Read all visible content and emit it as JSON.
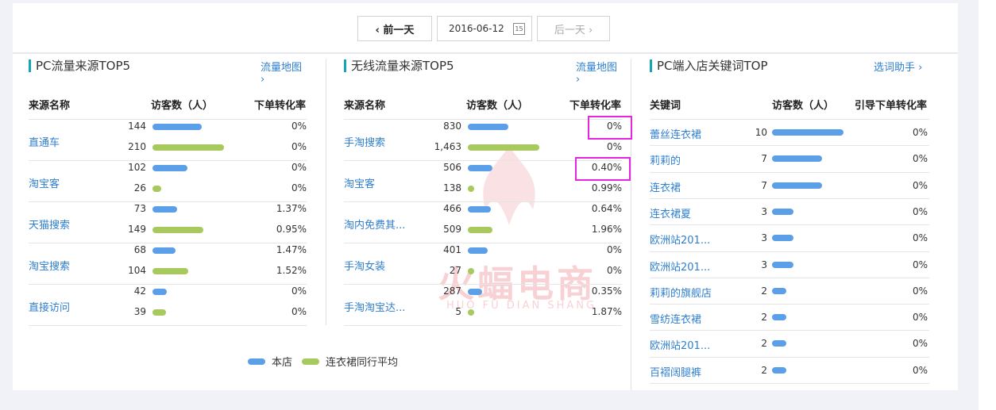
{
  "datebar": {
    "prev_label": "‹ 前一天",
    "date": "2016-06-12",
    "cal_day": "15",
    "next_label": "后一天 ›"
  },
  "watermark": {
    "text": "火蝠电商",
    "sub": "HUO FU DIAN SHANG"
  },
  "colors": {
    "accent": "#16a4b9",
    "link": "#2f7fd0",
    "store_bar": "#5b9fe8",
    "industry_bar": "#a7c95e",
    "highlight": "#e526e0"
  },
  "pc_source": {
    "title": "PC流量来源TOP5",
    "link": "流量地图 ›",
    "headers": [
      "来源名称",
      "访客数（人）",
      "下单转化率"
    ],
    "rows": [
      {
        "name": "直通车",
        "store": {
          "visitors": "144",
          "rate": "0%",
          "v": 144
        },
        "industry": {
          "visitors": "210",
          "rate": "0%",
          "v": 210
        }
      },
      {
        "name": "淘宝客",
        "store": {
          "visitors": "102",
          "rate": "0%",
          "v": 102
        },
        "industry": {
          "visitors": "26",
          "rate": "0%",
          "v": 26
        }
      },
      {
        "name": "天猫搜索",
        "store": {
          "visitors": "73",
          "rate": "1.37%",
          "v": 73
        },
        "industry": {
          "visitors": "149",
          "rate": "0.95%",
          "v": 149
        }
      },
      {
        "name": "淘宝搜索",
        "store": {
          "visitors": "68",
          "rate": "1.47%",
          "v": 68
        },
        "industry": {
          "visitors": "104",
          "rate": "1.52%",
          "v": 104
        }
      },
      {
        "name": "直接访问",
        "store": {
          "visitors": "42",
          "rate": "0%",
          "v": 42
        },
        "industry": {
          "visitors": "39",
          "rate": "0%",
          "v": 39
        }
      }
    ]
  },
  "mobile_source": {
    "title": "无线流量来源TOP5",
    "link": "流量地图 ›",
    "headers": [
      "来源名称",
      "访客数（人）",
      "下单转化率"
    ],
    "rows": [
      {
        "name": "手淘搜索",
        "store": {
          "visitors": "830",
          "rate": "0%",
          "v": 830
        },
        "industry": {
          "visitors": "1,463",
          "rate": "0%",
          "v": 1463
        }
      },
      {
        "name": "淘宝客",
        "store": {
          "visitors": "506",
          "rate": "0.40%",
          "v": 506
        },
        "industry": {
          "visitors": "138",
          "rate": "0.99%",
          "v": 138
        }
      },
      {
        "name": "淘内免费其...",
        "store": {
          "visitors": "466",
          "rate": "0.64%",
          "v": 466
        },
        "industry": {
          "visitors": "509",
          "rate": "1.96%",
          "v": 509
        }
      },
      {
        "name": "手淘女装",
        "store": {
          "visitors": "401",
          "rate": "0%",
          "v": 401
        },
        "industry": {
          "visitors": "27",
          "rate": "0%",
          "v": 27
        }
      },
      {
        "name": "手淘淘宝达...",
        "store": {
          "visitors": "287",
          "rate": "0.35%",
          "v": 287
        },
        "industry": {
          "visitors": "5",
          "rate": "1.87%",
          "v": 5
        }
      }
    ]
  },
  "keywords": {
    "title": "PC端入店关键词TOP",
    "link": "选词助手 ›",
    "headers": [
      "关键词",
      "访客数（人）",
      "引导下单转化率"
    ],
    "rows": [
      {
        "name": "蕾丝连衣裙",
        "visitors": "10",
        "rate": "0%",
        "v": 10
      },
      {
        "name": "莉莉的",
        "visitors": "7",
        "rate": "0%",
        "v": 7
      },
      {
        "name": "连衣裙",
        "visitors": "7",
        "rate": "0%",
        "v": 7
      },
      {
        "name": "连衣裙夏",
        "visitors": "3",
        "rate": "0%",
        "v": 3
      },
      {
        "name": "欧洲站201...",
        "visitors": "3",
        "rate": "0%",
        "v": 3
      },
      {
        "name": "欧洲站201...",
        "visitors": "3",
        "rate": "0%",
        "v": 3
      },
      {
        "name": "莉莉的旗舰店",
        "visitors": "2",
        "rate": "0%",
        "v": 2
      },
      {
        "name": "雪纺连衣裙",
        "visitors": "2",
        "rate": "0%",
        "v": 2
      },
      {
        "name": "欧洲站201...",
        "visitors": "2",
        "rate": "0%",
        "v": 2
      },
      {
        "name": "百褶阔腿裤",
        "visitors": "2",
        "rate": "0%",
        "v": 2
      }
    ]
  },
  "legend": {
    "store": "本店",
    "industry": "连衣裙同行平均"
  }
}
